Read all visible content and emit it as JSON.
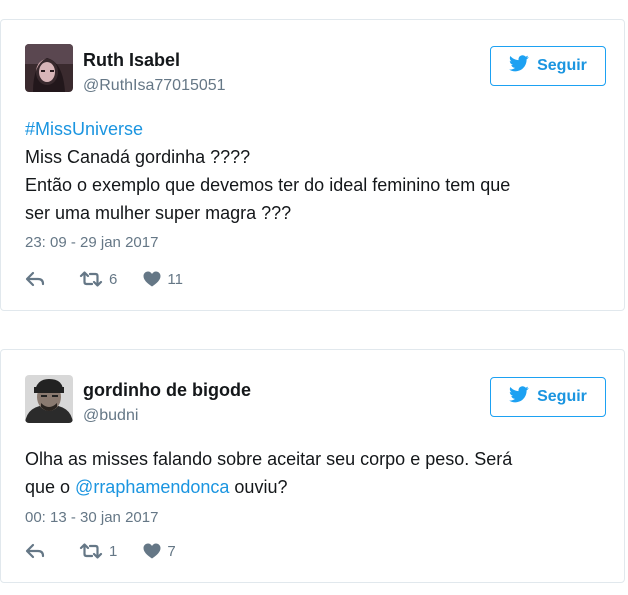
{
  "tweets": [
    {
      "name": "Ruth Isabel",
      "handle": "@RuthIsa77015051",
      "follow_label": "Seguir",
      "lines": [
        {
          "hashtag": "#MissUniverse"
        },
        {
          "text": "Miss Canadá gordinha ????"
        },
        {
          "text": "Então o exemplo que devemos ter do ideal feminino tem que"
        },
        {
          "text": "ser uma mulher super magra ???"
        }
      ],
      "timestamp": "23: 09 - 29 jan 2017",
      "retweets": "6",
      "likes": "11",
      "icons": [
        "avatar",
        "twitter-bird-icon",
        "reply-icon",
        "retweet-icon",
        "heart-icon"
      ]
    },
    {
      "name": "gordinho de bigode",
      "handle": "@budni",
      "follow_label": "Seguir",
      "line1": "Olha as misses falando sobre aceitar seu corpo e peso. Será",
      "line2_prefix": "que o ",
      "line2_mention": "@rraphamendonca",
      "line2_suffix": " ouviu?",
      "timestamp": "00: 13 - 30 jan 2017",
      "retweets": "1",
      "likes": "7",
      "icons": [
        "avatar",
        "twitter-bird-icon",
        "reply-icon",
        "retweet-icon",
        "heart-icon"
      ]
    }
  ],
  "colors": {
    "accent": "#1b95e0",
    "text": "#14171a",
    "muted": "#657786",
    "border": "#e1e8ed"
  }
}
